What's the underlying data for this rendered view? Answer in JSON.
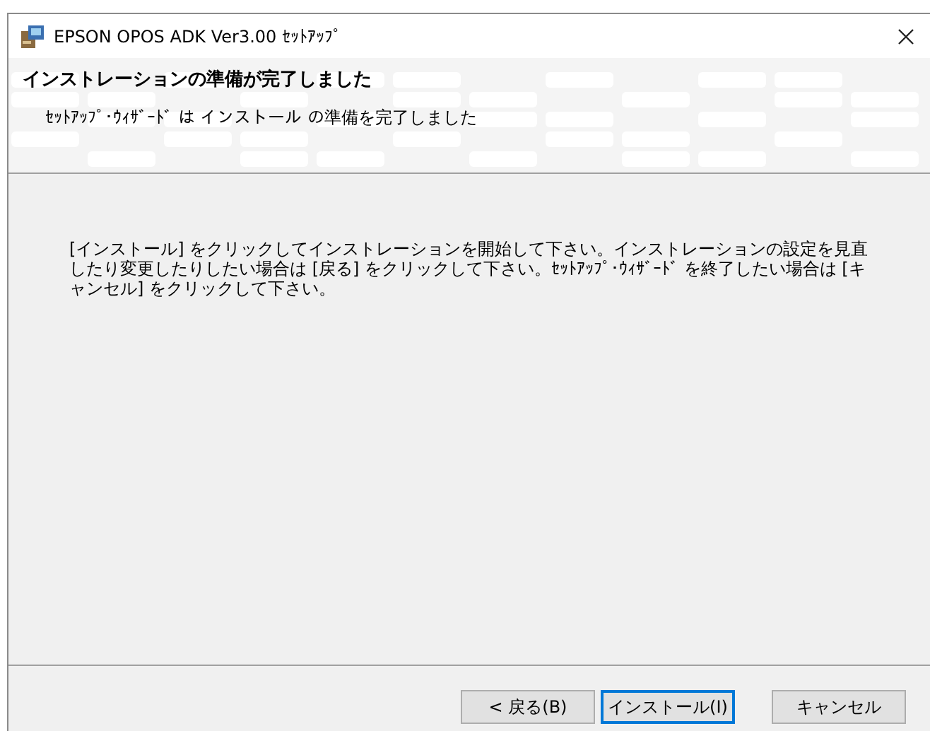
{
  "window": {
    "title": "EPSON OPOS ADK Ver3.00 ｾｯﾄｱｯﾌﾟ"
  },
  "header": {
    "title": "インストレーションの準備が完了しました",
    "subtitle": "ｾｯﾄｱｯﾌﾟ･ｳｨｻﾞｰﾄﾞ は インストール の準備を完了しました"
  },
  "body": {
    "text": "[インストール] をクリックしてインストレーションを開始して下さい。インストレーションの設定を見直したり変更したりしたい場合は [戻る] をクリックして下さい。ｾｯﾄｱｯﾌﾟ･ｳｨｻﾞｰﾄﾞ を終了したい場合は [キャンセル] をクリックして下さい。"
  },
  "buttons": [
    {
      "label": "< 戻る(B)",
      "focused": false
    },
    {
      "label": "インストール(I)",
      "focused": true
    },
    {
      "label": "キャンセル",
      "focused": false
    }
  ]
}
